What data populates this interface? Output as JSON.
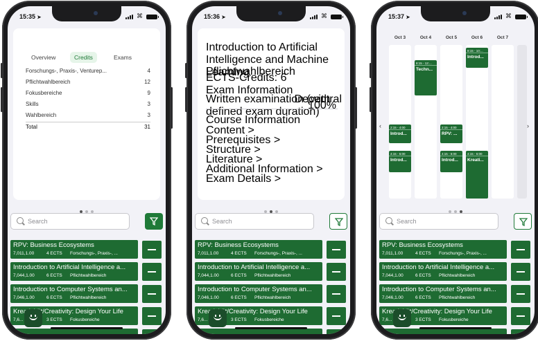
{
  "status": {
    "time1": "15:35",
    "time2": "15:36",
    "time3": "15:37"
  },
  "search": {
    "placeholder": "Search"
  },
  "credits_card": {
    "tabs": [
      "Overview",
      "Credits",
      "Exams"
    ],
    "rows": [
      {
        "label": "Forschungs-, Praxis-, Venturep...",
        "value": "4"
      },
      {
        "label": "Pflichtwahlbereich",
        "value": "12"
      },
      {
        "label": "Fokusbereiche",
        "value": "9"
      },
      {
        "label": "Skills",
        "value": "3"
      },
      {
        "label": "Wahlbereich",
        "value": "3"
      }
    ],
    "total_label": "Total",
    "total_value": "31"
  },
  "detail_card": {
    "title": "Introduction to Artificial Intelligence and Machine Learning",
    "area": "Pflichtwahlbereich",
    "ects": "ECTS-Credits: 6",
    "exam_heading": "Exam Information",
    "exam_desc": "Written examination (with defined exam duration)",
    "exam_type": "Decentral",
    "exam_pct": "100%",
    "course_heading": "Course Information",
    "links": [
      "Content >",
      "Prerequisites >",
      "Structure >",
      "Literature >",
      "Additional Information >",
      "Exam Details >"
    ]
  },
  "calendar": {
    "days": [
      "Oct 3",
      "Oct 4",
      "Oct 5",
      "Oct 6",
      "Oct 7"
    ],
    "events": [
      {
        "day": 0,
        "start": 0.52,
        "len": 0.12,
        "time": "2:15 - 4:00",
        "name": "Introd..."
      },
      {
        "day": 0,
        "start": 0.69,
        "len": 0.14,
        "time": "4:15 - 6:00",
        "name": "Introd..."
      },
      {
        "day": 1,
        "start": 0.1,
        "len": 0.23,
        "time": "8:15 - 12:...",
        "name": "Techn..."
      },
      {
        "day": 2,
        "start": 0.52,
        "len": 0.12,
        "time": "2:15 - 4:00",
        "name": "RPV: ..."
      },
      {
        "day": 2,
        "start": 0.69,
        "len": 0.14,
        "time": "4:15 - 6:00",
        "name": "Introd..."
      },
      {
        "day": 3,
        "start": 0.02,
        "len": 0.13,
        "time": "8:15 - 10:...",
        "name": "Introd..."
      },
      {
        "day": 3,
        "start": 0.69,
        "len": 0.31,
        "time": "4:15 - 6:00",
        "name": "Kreati..."
      }
    ]
  },
  "courses": [
    {
      "title": "RPV: Business Ecosystems",
      "number": "7,011,1.00",
      "ects": "4 ECTS",
      "area": "Forschungs-, Praxis-, ..."
    },
    {
      "title": "Introduction to Artificial Intelligence a...",
      "number": "7,044,1.00",
      "ects": "6 ECTS",
      "area": "Pflichtwahlbereich"
    },
    {
      "title": "Introduction to Computer Systems an...",
      "number": "7,046,1.00",
      "ects": "6 ECTS",
      "area": "Pflichtwahlbereich"
    },
    {
      "title": "Kreativität/Creativity: Design Your Life",
      "number": "7,6...",
      "ects": "3 ECTS",
      "area": "Fokusbereiche"
    }
  ],
  "colors": {
    "accent": "#1e6b32",
    "accent_light": "#e6f5e9"
  }
}
